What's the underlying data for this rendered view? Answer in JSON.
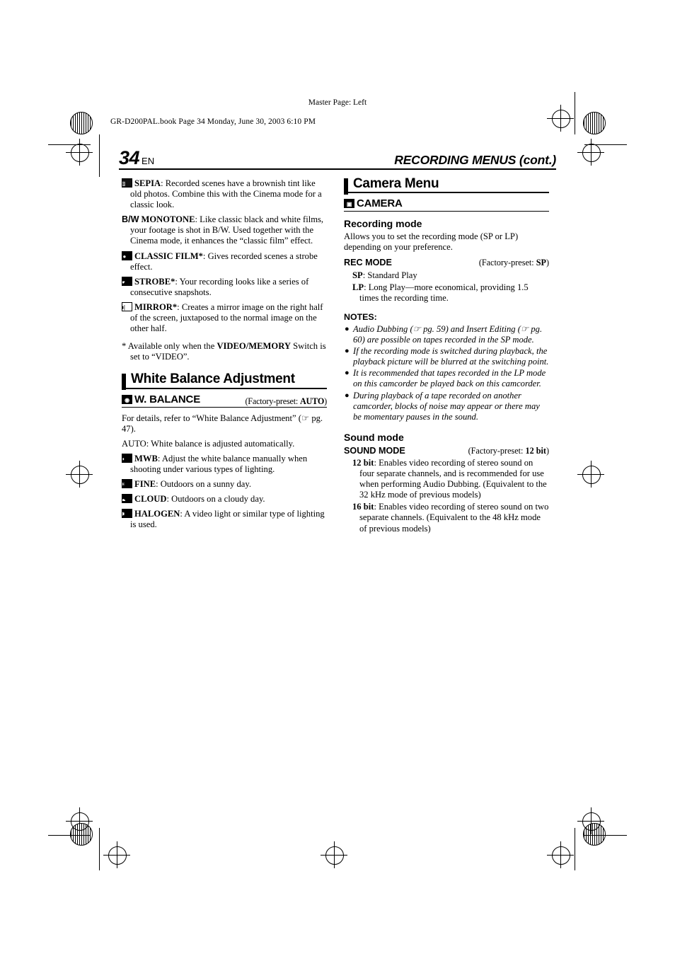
{
  "printer_marks": {
    "master_page": "Master Page: Left"
  },
  "file_bar": "GR-D200PAL.book  Page 34  Monday, June 30, 2003  6:10 PM",
  "running_head": {
    "page_number": "34",
    "page_unit": "EN",
    "title": "RECORDING MENUS (cont.)"
  },
  "left_column": {
    "effects": [
      {
        "icon": "sepia-icon",
        "icon_glyph": "◧",
        "name": "SEPIA",
        "text": ": Recorded scenes have a brownish tint like old photos. Combine this with the Cinema mode for a classic look."
      },
      {
        "icon": "bw-icon",
        "icon_glyph": "B/W",
        "name": "MONOTONE",
        "text": ": Like classic black and white films, your footage is shot in B/W. Used together with the Cinema mode, it enhances the “classic film” effect."
      },
      {
        "icon": "movie-camera-icon",
        "icon_glyph": "🎥",
        "name": "CLASSIC FILM",
        "star": "*",
        "text": ": Gives recorded scenes a strobe effect."
      },
      {
        "icon": "strobe-icon",
        "icon_glyph": "▆",
        "name": "STROBE",
        "star": "*",
        "text": ": Your recording looks like a series of consecutive snapshots."
      },
      {
        "icon": "mirror-icon",
        "icon_glyph": "▣",
        "name": "MIRROR",
        "star": "*",
        "text": ": Creates a mirror image on the right half of the screen, juxtaposed to the normal image on the other half."
      }
    ],
    "footnote": {
      "marker": "*",
      "text_before": "Available only when the ",
      "bold": "VIDEO/MEMORY",
      "text_after": " Switch is set to “VIDEO”."
    },
    "section": {
      "heading": "White Balance Adjustment",
      "menu_icon": "white-balance-icon",
      "menu_label": "W. BALANCE",
      "factory_prefix": "(Factory-preset: ",
      "factory_value": "AUTO",
      "factory_suffix": ")",
      "intro": "For details, refer to “White Balance Adjustment” (☞ pg. 47).",
      "auto_line": "AUTO: White balance is adjusted automatically.",
      "options": [
        {
          "icon": "mwb-icon",
          "icon_glyph": "◑",
          "name": "MWB",
          "text": ": Adjust the white balance manually when shooting under various types of lighting."
        },
        {
          "icon": "sun-icon",
          "icon_glyph": "☀",
          "name": "FINE",
          "text": ": Outdoors on a sunny day."
        },
        {
          "icon": "cloud-icon",
          "icon_glyph": "☁",
          "name": "CLOUD",
          "text": ": Outdoors on a cloudy day."
        },
        {
          "icon": "halogen-icon",
          "icon_glyph": "✸",
          "name": "HALOGEN",
          "text": ": A video light or similar type of lighting is used."
        }
      ]
    }
  },
  "right_column": {
    "section_heading": "Camera Menu",
    "menu_icon": "camera-menu-icon",
    "menu_label": "CAMERA",
    "recording_mode": {
      "heading": "Recording mode",
      "intro": "Allows you to set the recording mode (SP or LP) depending on your preference.",
      "param_label": "REC MODE",
      "factory_prefix": "(Factory-preset: ",
      "factory_value": "SP",
      "factory_suffix": ")",
      "options": [
        {
          "name": "SP",
          "text": ": Standard Play"
        },
        {
          "name": "LP",
          "text": ": Long Play—more economical, providing 1.5 times the recording time."
        }
      ]
    },
    "notes_title": "NOTES:",
    "notes": [
      "Audio Dubbing (☞ pg. 59) and Insert Editing (☞ pg. 60) are possible on tapes recorded in the SP mode.",
      "If the recording mode is switched during playback, the playback picture will be blurred at the switching point.",
      "It is recommended that tapes recorded in the LP mode on this camcorder be played back on this camcorder.",
      "During playback of a tape recorded on another camcorder, blocks of noise may appear or there may be momentary pauses in the sound."
    ],
    "sound_mode": {
      "heading": "Sound mode",
      "param_label": "SOUND MODE",
      "factory_prefix": "(Factory-preset: ",
      "factory_value": "12 bit",
      "factory_suffix": ")",
      "options": [
        {
          "name": "12 bit",
          "text": ": Enables video recording of stereo sound on four separate channels, and is recommended for use when performing Audio Dubbing. (Equivalent to the 32 kHz mode of previous models)"
        },
        {
          "name": "16 bit",
          "text": ": Enables video recording of stereo sound on two separate channels. (Equivalent to the 48 kHz mode of previous models)"
        }
      ]
    }
  }
}
